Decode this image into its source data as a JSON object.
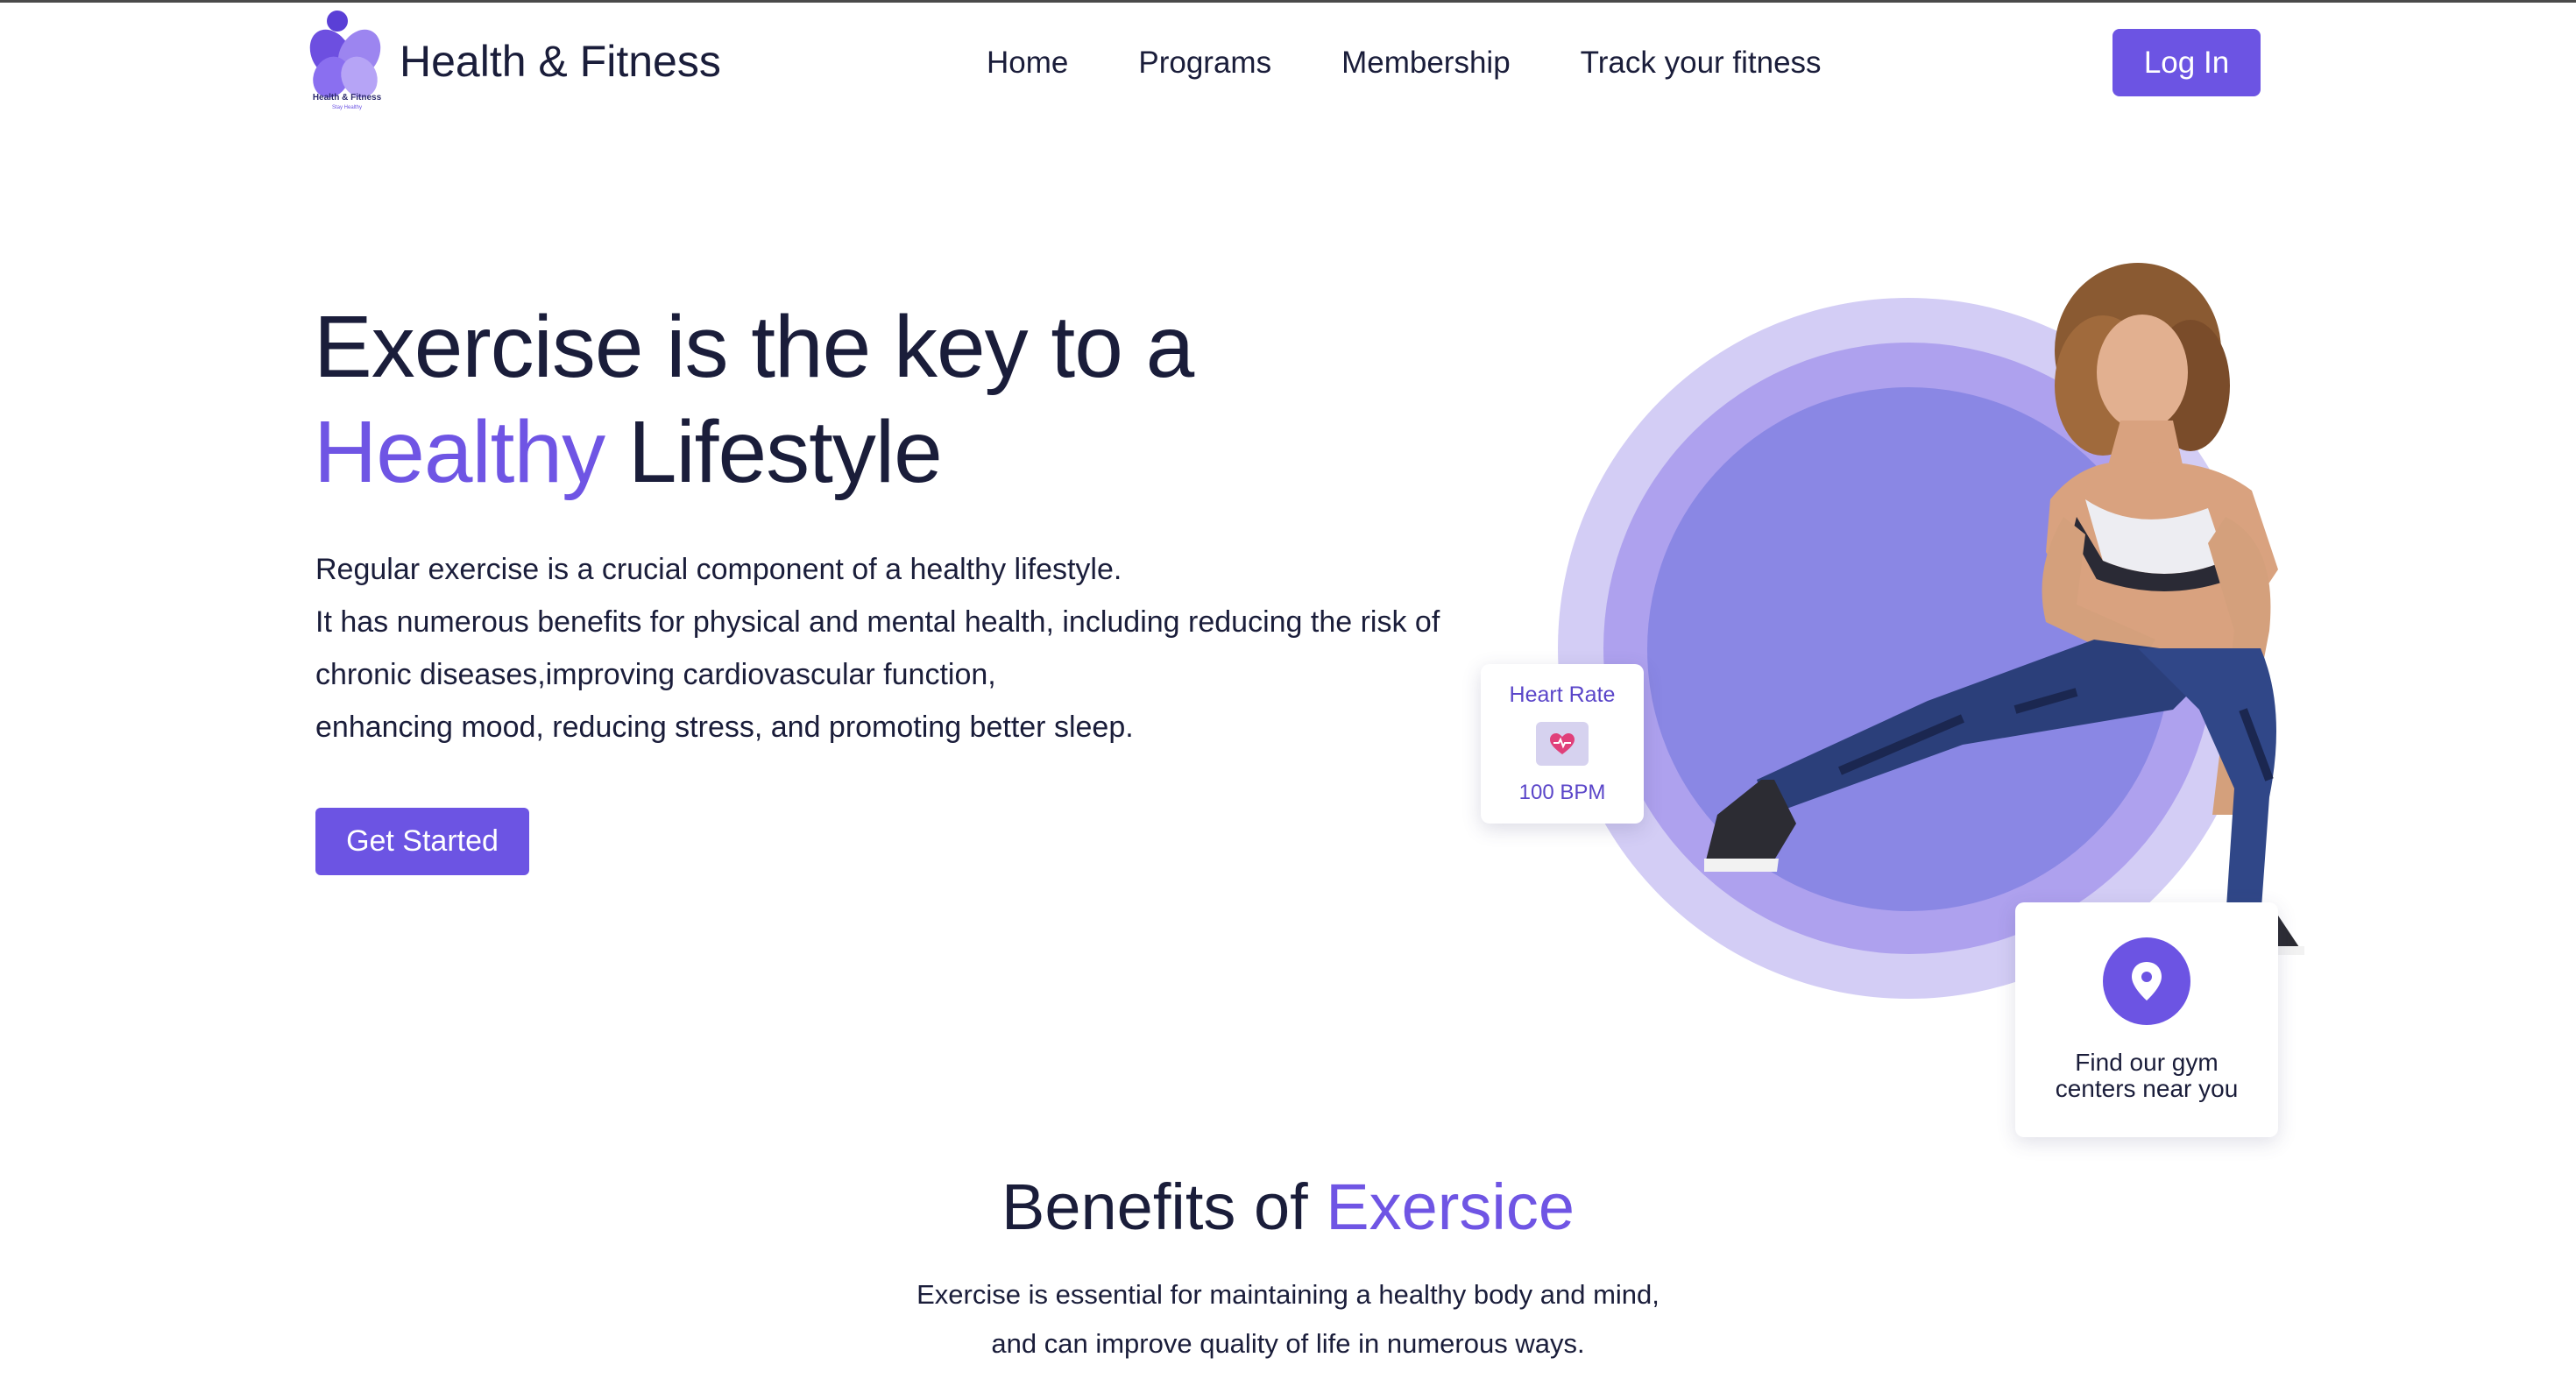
{
  "brand": {
    "name": "Health & Fitness",
    "logo_caption": "Health & Fitness",
    "logo_tagline": "Stay Healthy"
  },
  "nav": {
    "links": [
      {
        "label": "Home"
      },
      {
        "label": "Programs"
      },
      {
        "label": "Membership"
      },
      {
        "label": "Track your fitness"
      }
    ],
    "login_label": "Log In"
  },
  "hero": {
    "title_line1": "Exercise is the key to a",
    "title_accent": "Healthy",
    "title_rest": " Lifestyle",
    "description_lines": [
      "Regular exercise is a crucial component of a healthy lifestyle.",
      "It has numerous benefits for physical and mental health, including reducing the risk of",
      "chronic diseases,improving cardiovascular function,",
      "enhancing mood, reducing stress, and promoting better sleep."
    ],
    "cta_label": "Get Started"
  },
  "heart_card": {
    "label": "Heart Rate",
    "value": "100 BPM",
    "icon": "heart-pulse-icon"
  },
  "gym_card": {
    "line1": "Find our gym",
    "line2": "centers near you",
    "icon": "location-pin-icon"
  },
  "benefits": {
    "title_main": "Benefits of ",
    "title_accent": "Exersice",
    "description_lines": [
      "Exercise is essential for maintaining a healthy body and mind,",
      "and can improve quality of life in numerous ways."
    ]
  },
  "colors": {
    "accent": "#6c54e3",
    "text": "#1a1d3a",
    "circle_outer": "#d3cdf5",
    "circle_mid": "#aea1ee",
    "circle_inner": "#8a87e4"
  }
}
